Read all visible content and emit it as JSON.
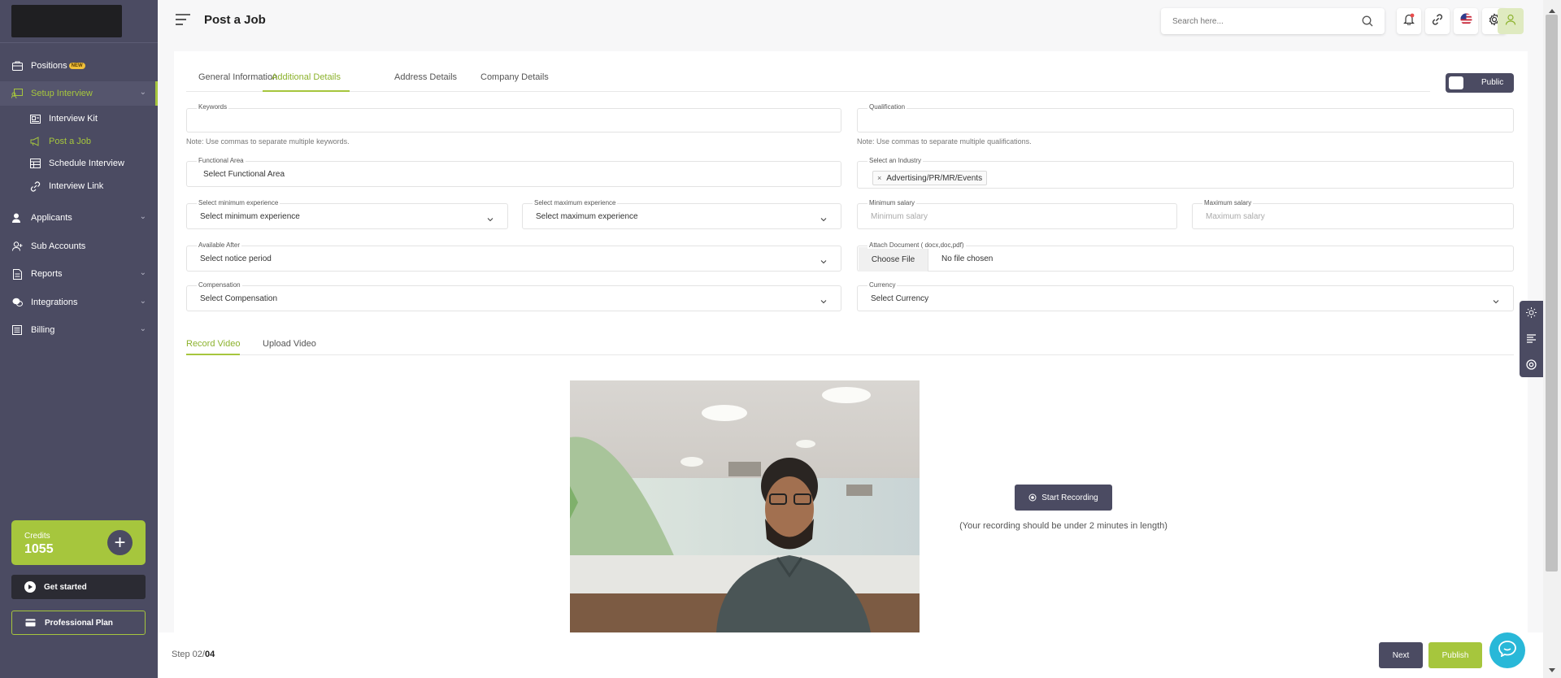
{
  "sidebar": {
    "items": [
      {
        "label": "Positions",
        "badge": "NEW",
        "icon": "briefcase-icon"
      },
      {
        "label": "Setup Interview",
        "icon": "monitor-user-icon"
      },
      {
        "label": "Applicants",
        "icon": "user-check-icon"
      },
      {
        "label": "Sub Accounts",
        "icon": "user-plus-icon"
      },
      {
        "label": "Reports",
        "icon": "file-report-icon"
      },
      {
        "label": "Integrations",
        "icon": "chat-bubbles-icon"
      },
      {
        "label": "Billing",
        "icon": "receipt-icon"
      }
    ],
    "sub_items": [
      {
        "label": "Interview Kit",
        "icon": "id-card-icon"
      },
      {
        "label": "Post a Job",
        "icon": "megaphone-icon"
      },
      {
        "label": "Schedule Interview",
        "icon": "calendar-grid-icon"
      },
      {
        "label": "Interview Link",
        "icon": "link-icon"
      }
    ],
    "credits": {
      "label": "Credits",
      "value": "1055"
    },
    "get_started": "Get started",
    "plan": "Professional Plan"
  },
  "header": {
    "title": "Post a Job",
    "search_placeholder": "Search here..."
  },
  "tabs": [
    "General Information",
    "Additional Details",
    "Address Details",
    "Company Details"
  ],
  "visibility_toggle": {
    "label": "Public"
  },
  "form": {
    "keywords": {
      "label": "Keywords",
      "note": "Note: Use commas to separate multiple keywords."
    },
    "qualification": {
      "label": "Qualification",
      "note": "Note: Use commas to separate multiple qualifications."
    },
    "functional_area": {
      "label": "Functional Area",
      "value": "Select Functional Area"
    },
    "industry": {
      "label": "Select an Industry",
      "chip": "Advertising/PR/MR/Events",
      "chip_remove": "×"
    },
    "min_experience": {
      "label": "Select minimum experience",
      "value": "Select minimum experience"
    },
    "max_experience": {
      "label": "Select maximum experience",
      "value": "Select maximum experience"
    },
    "min_salary": {
      "label": "Minimum salary",
      "placeholder": "Minimum salary"
    },
    "max_salary": {
      "label": "Maximum salary",
      "placeholder": "Maximum salary"
    },
    "available_after": {
      "label": "Available After",
      "value": "Select notice period"
    },
    "attach": {
      "label": "Attach Document ( docx,doc,pdf)",
      "button": "Choose File",
      "status": "No file chosen"
    },
    "compensation": {
      "label": "Compensation",
      "value": "Select Compensation"
    },
    "currency": {
      "label": "Currency",
      "value": "Select Currency"
    }
  },
  "video_tabs": [
    "Record Video",
    "Upload Video"
  ],
  "recording": {
    "button": "Start Recording",
    "note": "(Your recording should be under 2 minutes in length)"
  },
  "footer": {
    "step_prefix": "Step 02/",
    "step_total": "04",
    "next": "Next",
    "publish": "Publish"
  },
  "colors": {
    "sidebar": "#4b4b62",
    "accent": "#a6c63d",
    "chat": "#29b8d8"
  }
}
